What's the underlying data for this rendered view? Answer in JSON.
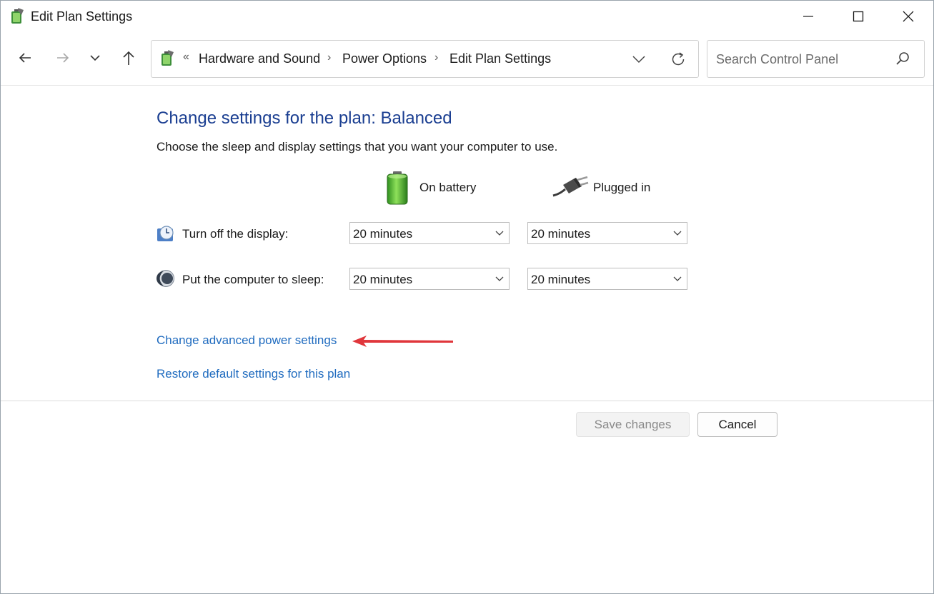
{
  "window": {
    "title": "Edit Plan Settings",
    "controls": {
      "minimize": "minimize-icon",
      "maximize": "maximize-icon",
      "close": "close-icon"
    }
  },
  "navigation": {
    "back": "back-arrow-icon",
    "forward": "forward-arrow-icon",
    "recent": "chevron-down-icon",
    "up": "up-arrow-icon"
  },
  "address_bar": {
    "overflow": "«",
    "crumbs": [
      "Hardware and Sound",
      "Power Options",
      "Edit Plan Settings"
    ],
    "separator": "›"
  },
  "search": {
    "placeholder": "Search Control Panel",
    "value": ""
  },
  "content": {
    "heading": "Change settings for the plan: Balanced",
    "description": "Choose the sleep and display settings that you want your computer to use.",
    "columns": {
      "on_battery": "On battery",
      "plugged_in": "Plugged in"
    },
    "rows": [
      {
        "label": "Turn off the display:",
        "on_battery": "20 minutes",
        "plugged_in": "20 minutes"
      },
      {
        "label": "Put the computer to sleep:",
        "on_battery": "20 minutes",
        "plugged_in": "20 minutes"
      }
    ],
    "links": {
      "advanced": "Change advanced power settings",
      "restore": "Restore default settings for this plan"
    }
  },
  "footer": {
    "save": "Save changes",
    "cancel": "Cancel"
  },
  "colors": {
    "heading": "#1a3e91",
    "link": "#1f6bbf",
    "annotation_arrow": "#e0363b"
  }
}
